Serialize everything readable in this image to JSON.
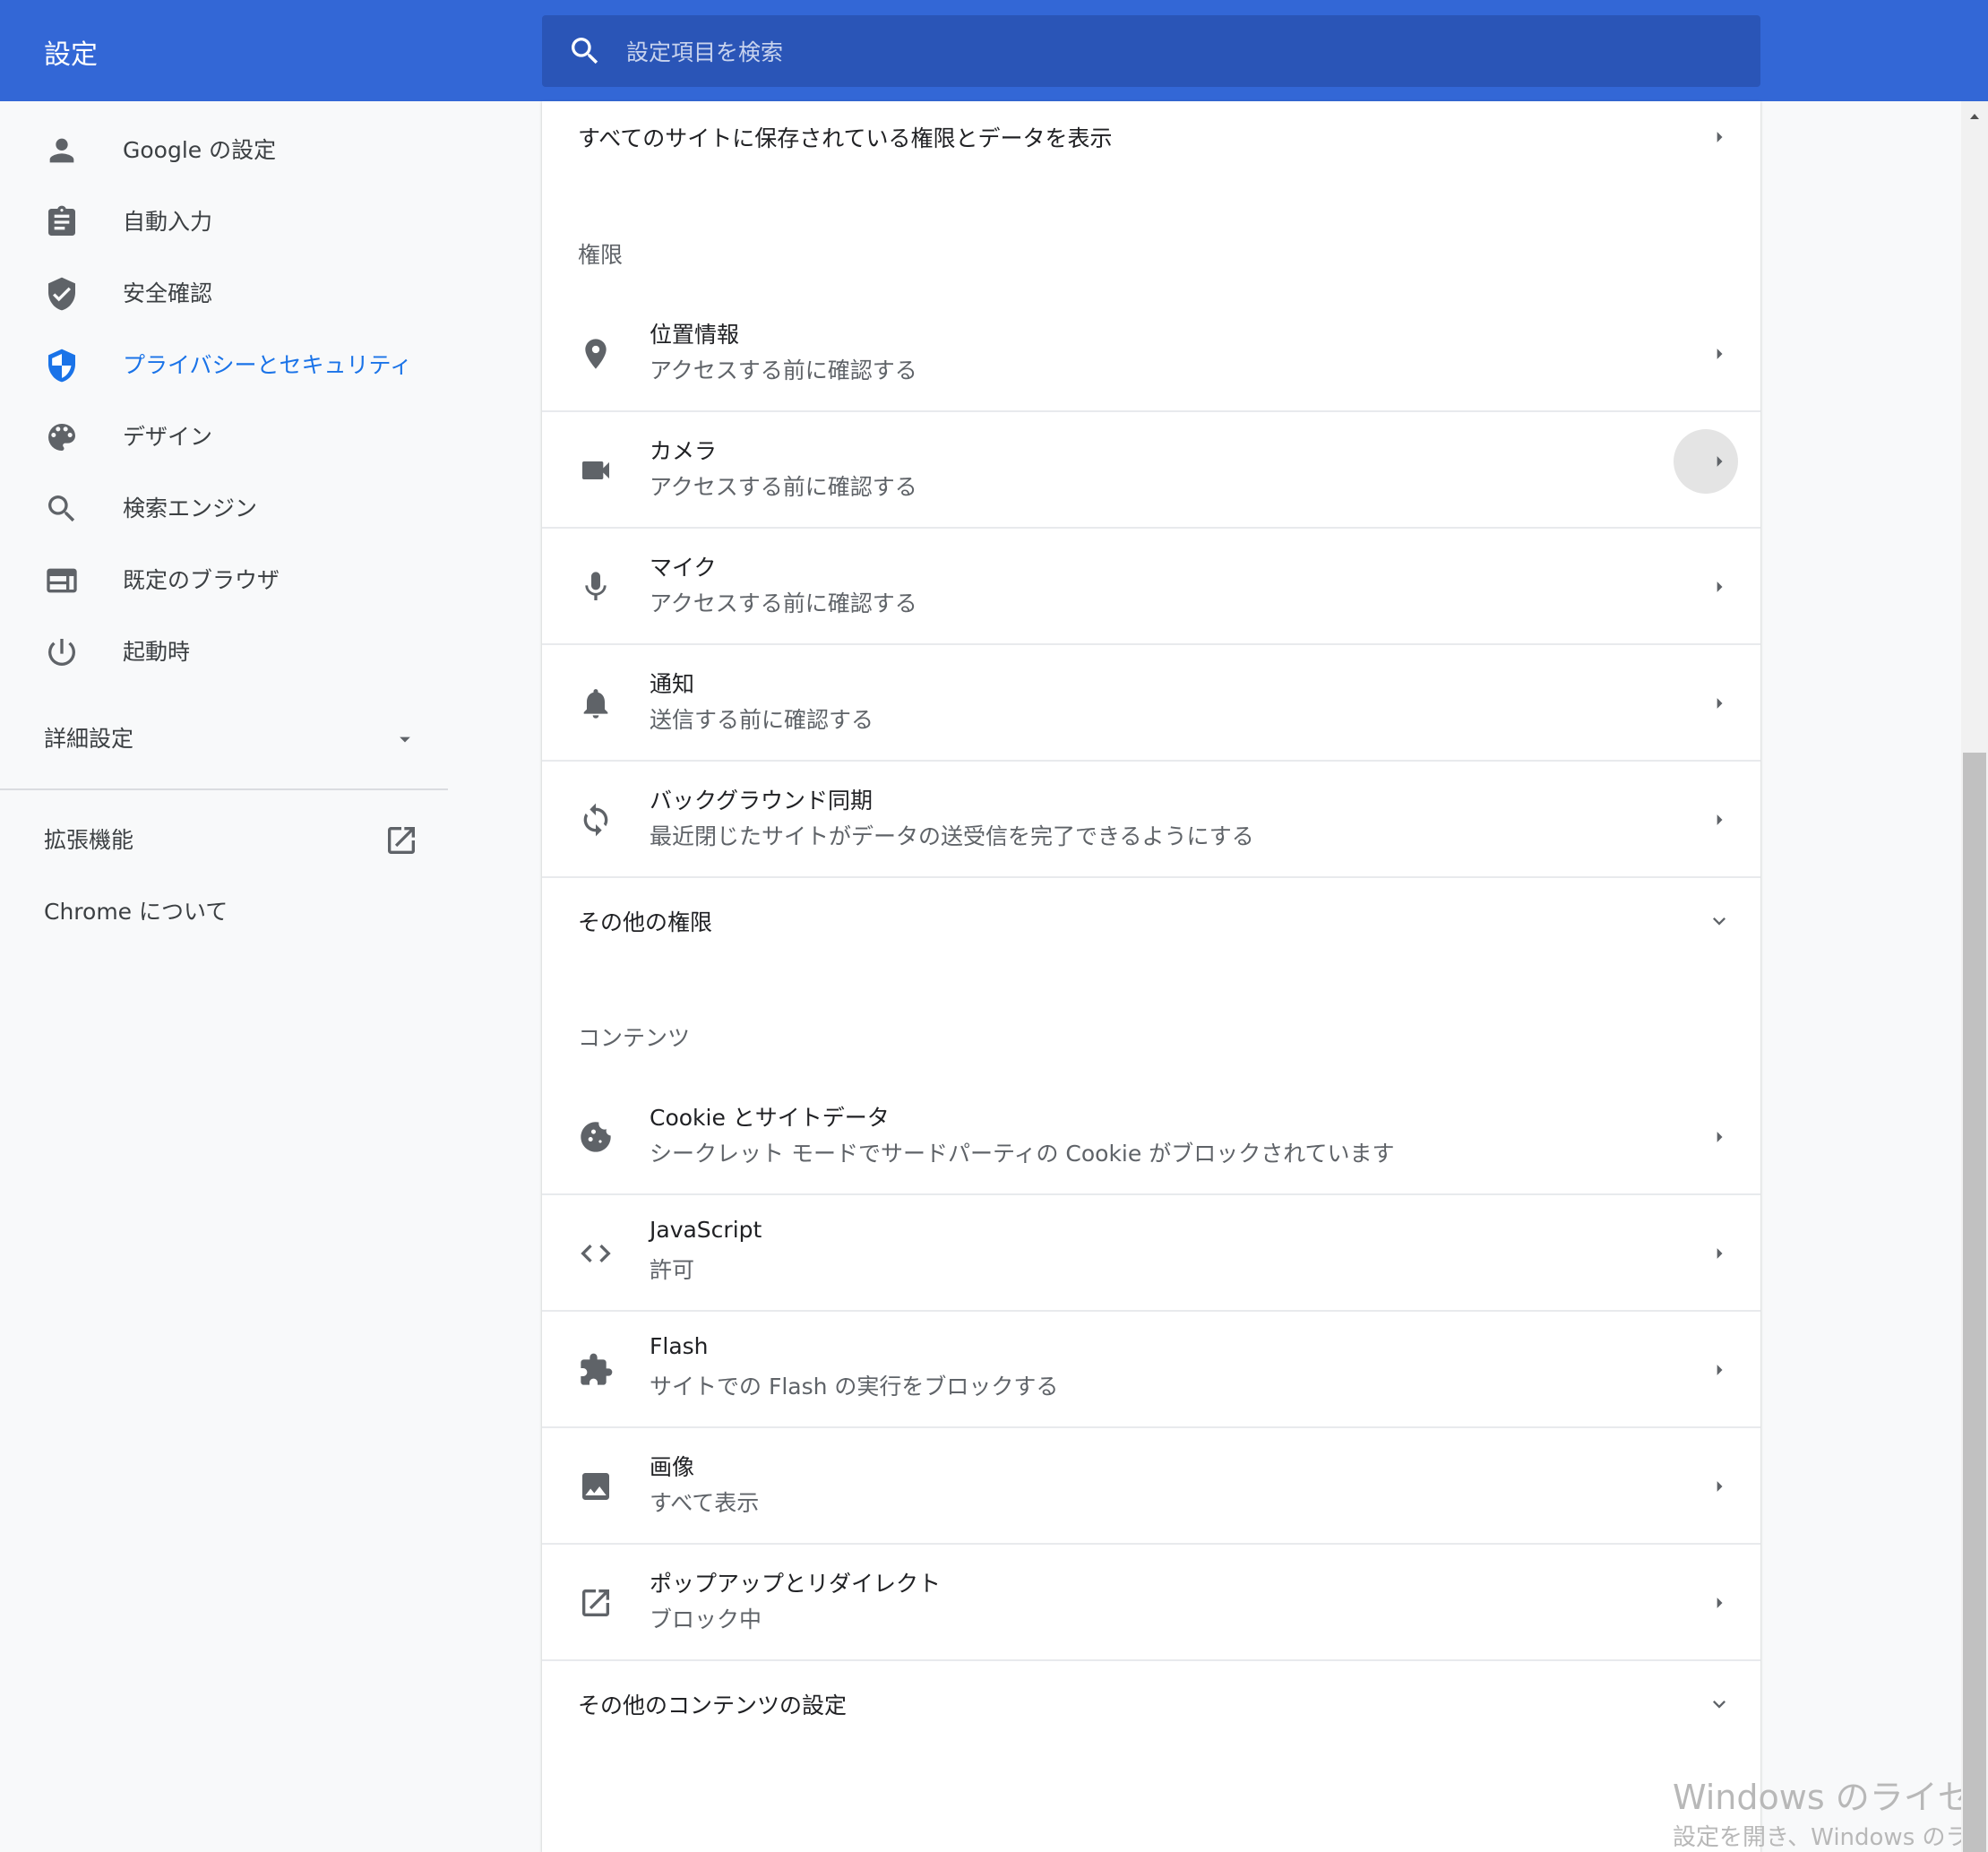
{
  "header": {
    "title": "設定",
    "search_placeholder": "設定項目を検索"
  },
  "sidebar": {
    "items": [
      {
        "label": "Google の設定",
        "icon": "person-icon"
      },
      {
        "label": "自動入力",
        "icon": "clipboard-icon"
      },
      {
        "label": "安全確認",
        "icon": "shield-check-icon"
      },
      {
        "label": "プライバシーとセキュリティ",
        "icon": "shield-half-icon",
        "active": true
      },
      {
        "label": "デザイン",
        "icon": "palette-icon"
      },
      {
        "label": "検索エンジン",
        "icon": "search-icon"
      },
      {
        "label": "既定のブラウザ",
        "icon": "browser-icon"
      },
      {
        "label": "起動時",
        "icon": "power-icon"
      }
    ],
    "advanced_label": "詳細設定",
    "extensions_label": "拡張機能",
    "about_label": "Chrome について"
  },
  "main": {
    "all_sites_label": "すべてのサイトに保存されている権限とデータを表示",
    "permissions_heading": "権限",
    "permissions": [
      {
        "title": "位置情報",
        "subtitle": "アクセスする前に確認する",
        "icon": "location-pin-icon"
      },
      {
        "title": "カメラ",
        "subtitle": "アクセスする前に確認する",
        "icon": "camera-icon"
      },
      {
        "title": "マイク",
        "subtitle": "アクセスする前に確認する",
        "icon": "mic-icon"
      },
      {
        "title": "通知",
        "subtitle": "送信する前に確認する",
        "icon": "bell-icon"
      },
      {
        "title": "バックグラウンド同期",
        "subtitle": "最近閉じたサイトがデータの送受信を完了できるようにする",
        "icon": "sync-icon"
      }
    ],
    "more_permissions_label": "その他の権限",
    "content_heading": "コンテンツ",
    "content": [
      {
        "title": "Cookie とサイトデータ",
        "subtitle": "シークレット モードでサードパーティの Cookie がブロックされています",
        "icon": "cookie-icon"
      },
      {
        "title": "JavaScript",
        "subtitle": "許可",
        "icon": "code-icon"
      },
      {
        "title": "Flash",
        "subtitle": "サイトでの Flash の実行をブロックする",
        "icon": "puzzle-icon"
      },
      {
        "title": "画像",
        "subtitle": "すべて表示",
        "icon": "image-icon"
      },
      {
        "title": "ポップアップとリダイレクト",
        "subtitle": "ブロック中",
        "icon": "open-in-new-icon"
      }
    ],
    "more_content_label": "その他のコンテンツの設定"
  },
  "watermark": {
    "line1": "Windows のライセンス",
    "line2": "設定を開き、Windows のライセ"
  },
  "colors": {
    "header_bg": "#3367d6",
    "search_bg": "#2a55b7",
    "accent": "#1a73e8",
    "icon_gray": "#5f6368"
  }
}
